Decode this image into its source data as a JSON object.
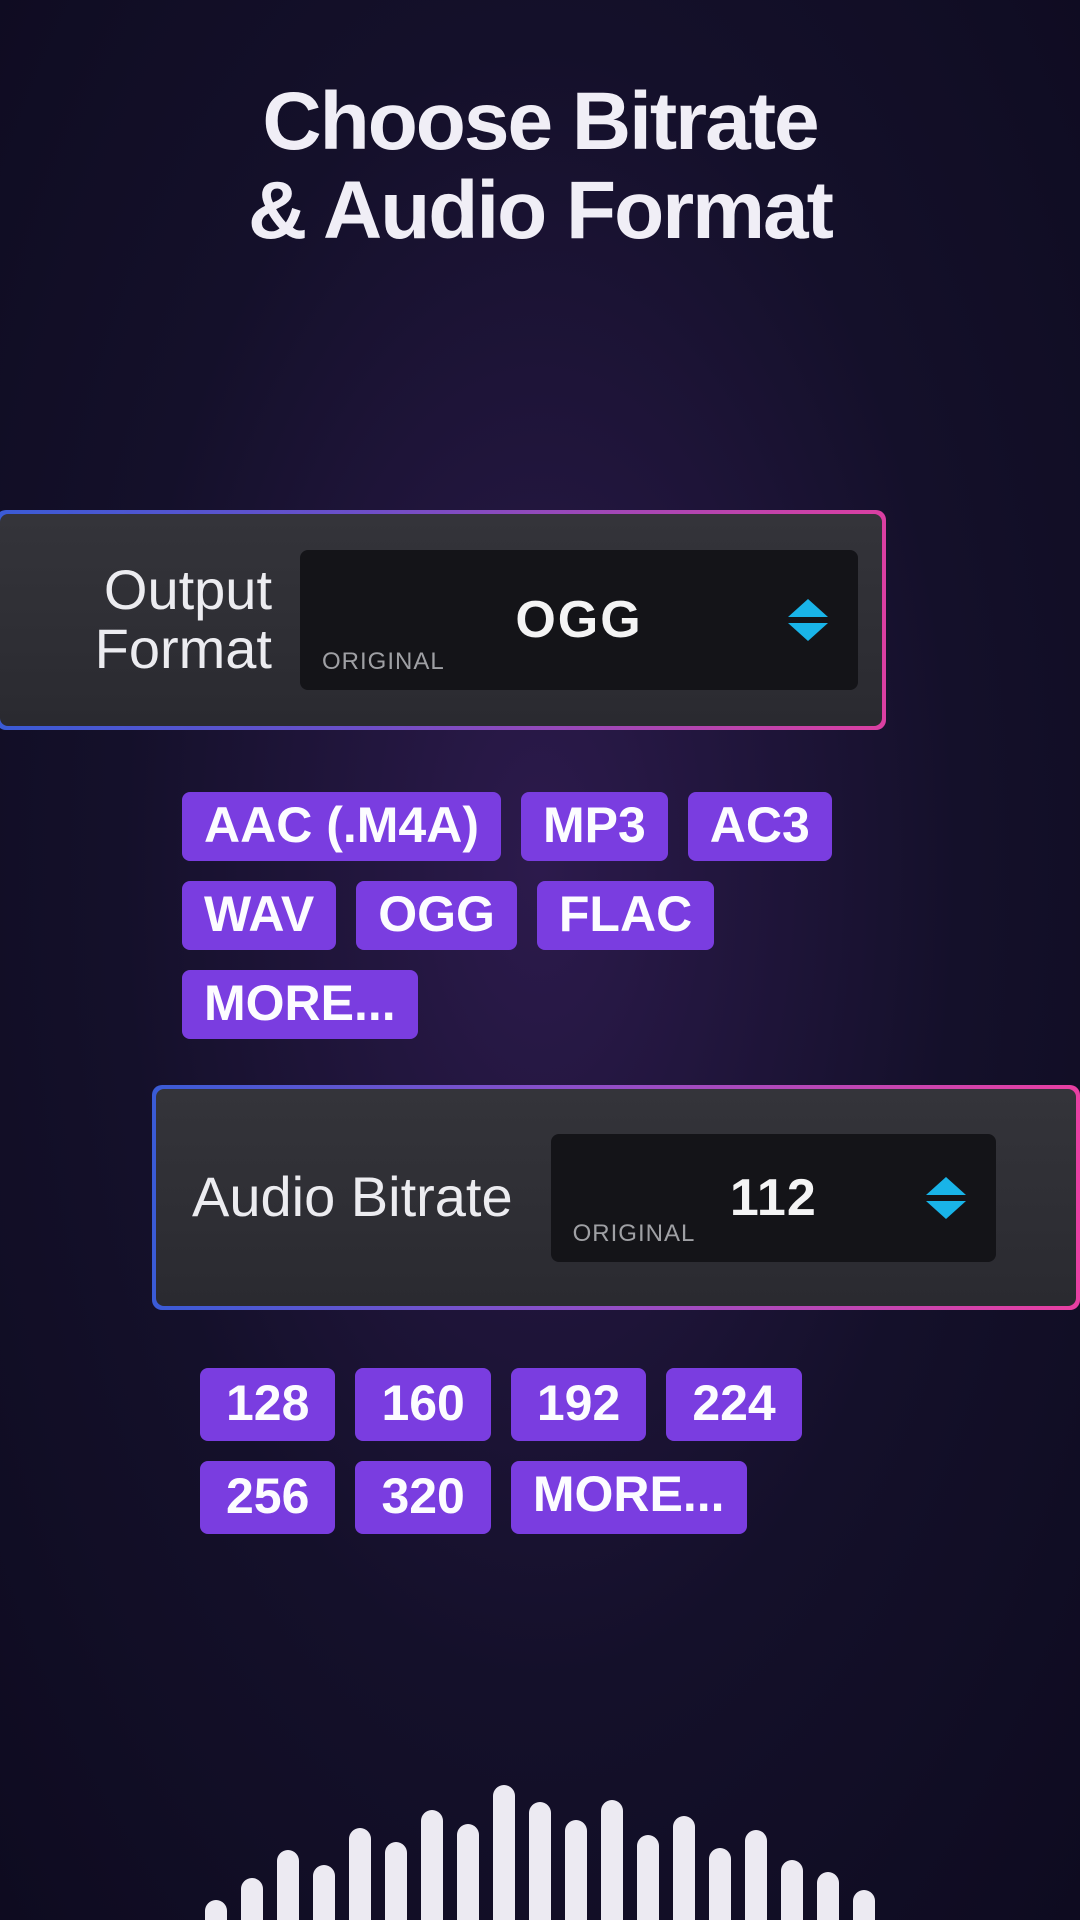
{
  "title_line1": "Choose Bitrate",
  "title_line2": "& Audio Format",
  "output_format": {
    "label_line1": "Output",
    "label_line2": "Format",
    "value": "OGG",
    "original_tag": "ORIGINAL",
    "options": [
      "AAC (.M4A)",
      "MP3",
      "AC3",
      "WAV",
      "OGG",
      "FLAC",
      "MORE..."
    ]
  },
  "audio_bitrate": {
    "label": "Audio Bitrate",
    "value": "112",
    "original_tag": "ORIGINAL",
    "options": [
      "128",
      "160",
      "192",
      "224",
      "256",
      "320",
      "MORE..."
    ]
  },
  "colors": {
    "accent": "#7a3de0",
    "spinner": "#19b4e8",
    "border_start": "#3a5bd6",
    "border_end": "#e83fa2"
  }
}
